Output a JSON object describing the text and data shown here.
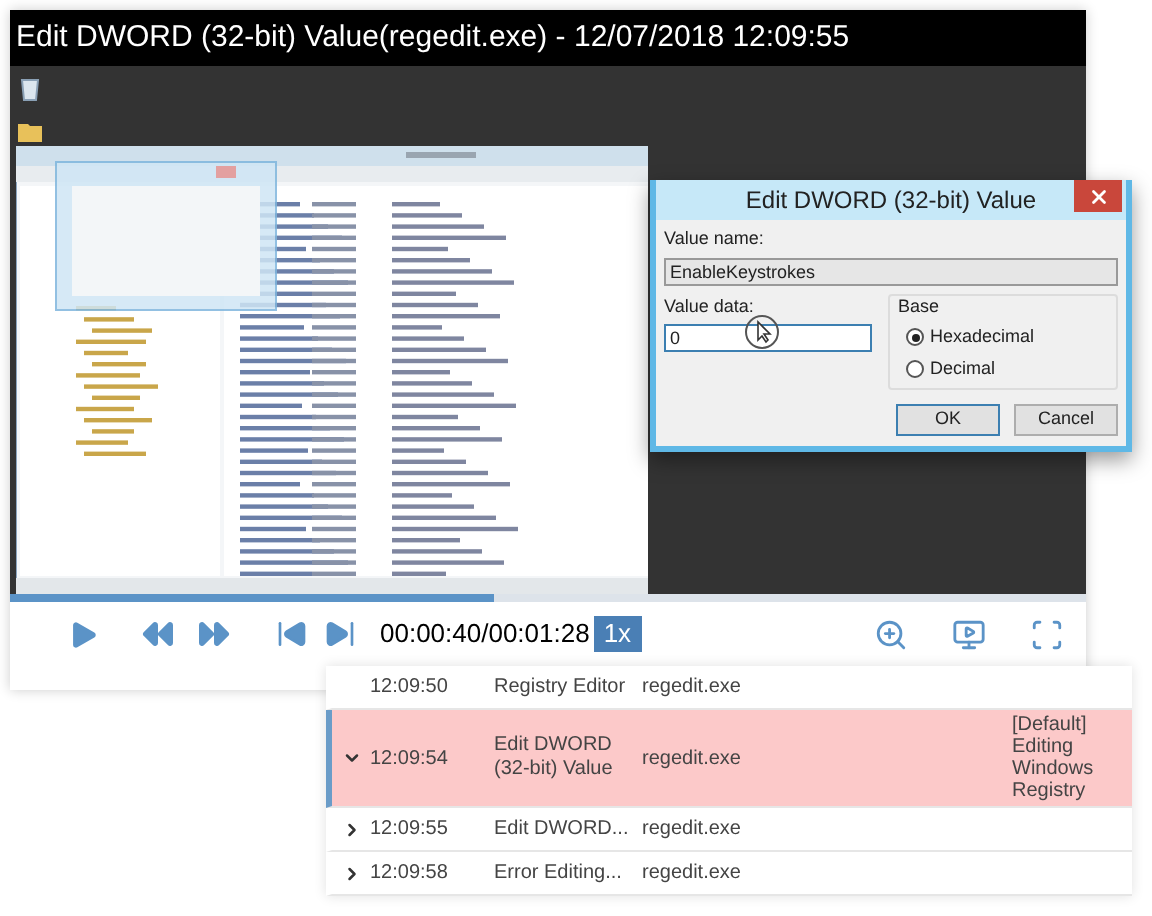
{
  "player": {
    "title": "Edit DWORD (32-bit) Value(regedit.exe) - 12/07/2018 12:09:55",
    "progress": {
      "level": 0.45
    },
    "time": "00:00:40/00:01:28",
    "speed": "1x"
  },
  "dialog": {
    "title": "Edit DWORD (32-bit) Value",
    "value_name_label": "Value name:",
    "value_name": "EnableKeystrokes",
    "value_data_label": "Value data:",
    "value_data": "0",
    "base_label": "Base",
    "base_options": [
      {
        "label": "Hexadecimal",
        "selected": true
      },
      {
        "label": "Decimal",
        "selected": false
      }
    ],
    "buttons": [
      "OK",
      "Cancel"
    ]
  },
  "events": [
    {
      "time": "12:09:50",
      "title": "Registry Editor",
      "process": "regedit.exe",
      "selected": false
    },
    {
      "time": "12:09:54",
      "title": "Edit DWORD (32-bit) Value",
      "process": "regedit.exe",
      "details": "[Default] Editing Windows Registry",
      "selected": true,
      "expanded": true
    },
    {
      "time": "12:09:55",
      "title": "Edit DWORD...",
      "process": "regedit.exe",
      "selected": false,
      "expanded": false
    },
    {
      "time": "12:09:58",
      "title": "Error Editing...",
      "process": "regedit.exe",
      "selected": false,
      "expanded": false
    }
  ]
}
